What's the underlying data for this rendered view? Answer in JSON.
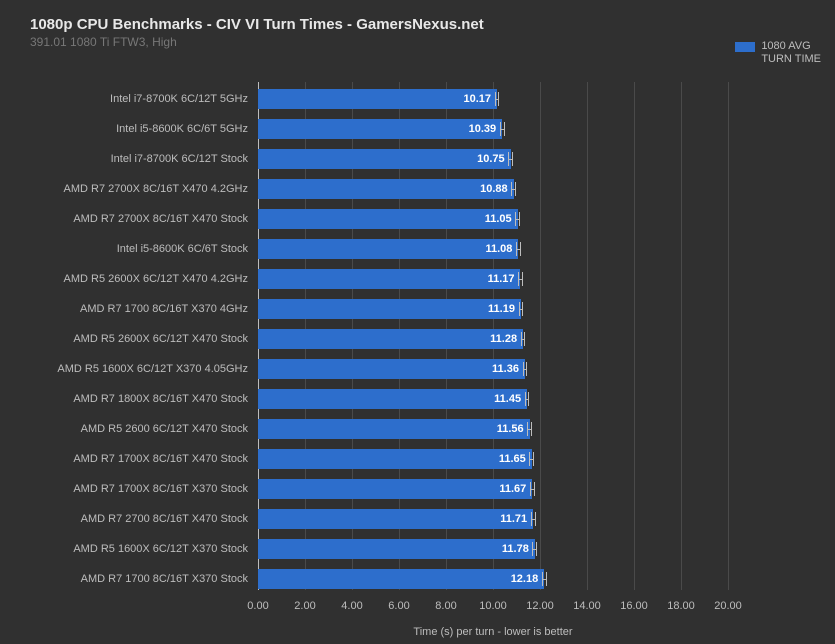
{
  "title": "1080p CPU Benchmarks - CIV VI Turn Times - GamersNexus.net",
  "subtitle": "391.01 1080 Ti FTW3, High",
  "legend": {
    "label": "1080 AVG\nTURN TIME",
    "color": "#2d6ecc"
  },
  "xlabel": "Time (s) per turn - lower is better",
  "chart_data": {
    "type": "bar",
    "orientation": "horizontal",
    "categories": [
      "Intel i7-8700K 6C/12T 5GHz",
      "Intel i5-8600K 6C/6T 5GHz",
      "Intel i7-8700K 6C/12T Stock",
      "AMD R7 2700X 8C/16T X470 4.2GHz",
      "AMD R7 2700X 8C/16T X470 Stock",
      "Intel i5-8600K 6C/6T Stock",
      "AMD R5 2600X 6C/12T X470 4.2GHz",
      "AMD R7 1700 8C/16T X370 4GHz",
      "AMD R5 2600X 6C/12T X470 Stock",
      "AMD R5 1600X 6C/12T X370 4.05GHz",
      "AMD R7 1800X 8C/16T X470 Stock",
      "AMD R5 2600 6C/12T X470 Stock",
      "AMD R7 1700X 8C/16T X470 Stock",
      "AMD R7 1700X 8C/16T X370 Stock",
      "AMD R7 2700 8C/16T X470 Stock",
      "AMD R5 1600X 6C/12T X370 Stock",
      "AMD R7 1700 8C/16T X370 Stock"
    ],
    "values": [
      10.17,
      10.39,
      10.75,
      10.88,
      11.05,
      11.08,
      11.17,
      11.19,
      11.28,
      11.36,
      11.45,
      11.56,
      11.65,
      11.67,
      11.71,
      11.78,
      12.18
    ],
    "error": [
      0.1,
      0.1,
      0.1,
      0.1,
      0.1,
      0.1,
      0.1,
      0.1,
      0.1,
      0.1,
      0.1,
      0.1,
      0.1,
      0.1,
      0.1,
      0.1,
      0.1
    ],
    "xlim": [
      0,
      20
    ],
    "xticks": [
      0,
      2,
      4,
      6,
      8,
      10,
      12,
      14,
      16,
      18,
      20
    ],
    "xtick_labels": [
      "0.00",
      "2.00",
      "4.00",
      "6.00",
      "8.00",
      "10.00",
      "12.00",
      "14.00",
      "16.00",
      "18.00",
      "20.00"
    ],
    "ylabel": "",
    "series_name": "1080 AVG TURN TIME",
    "color": "#2d6ecc"
  }
}
